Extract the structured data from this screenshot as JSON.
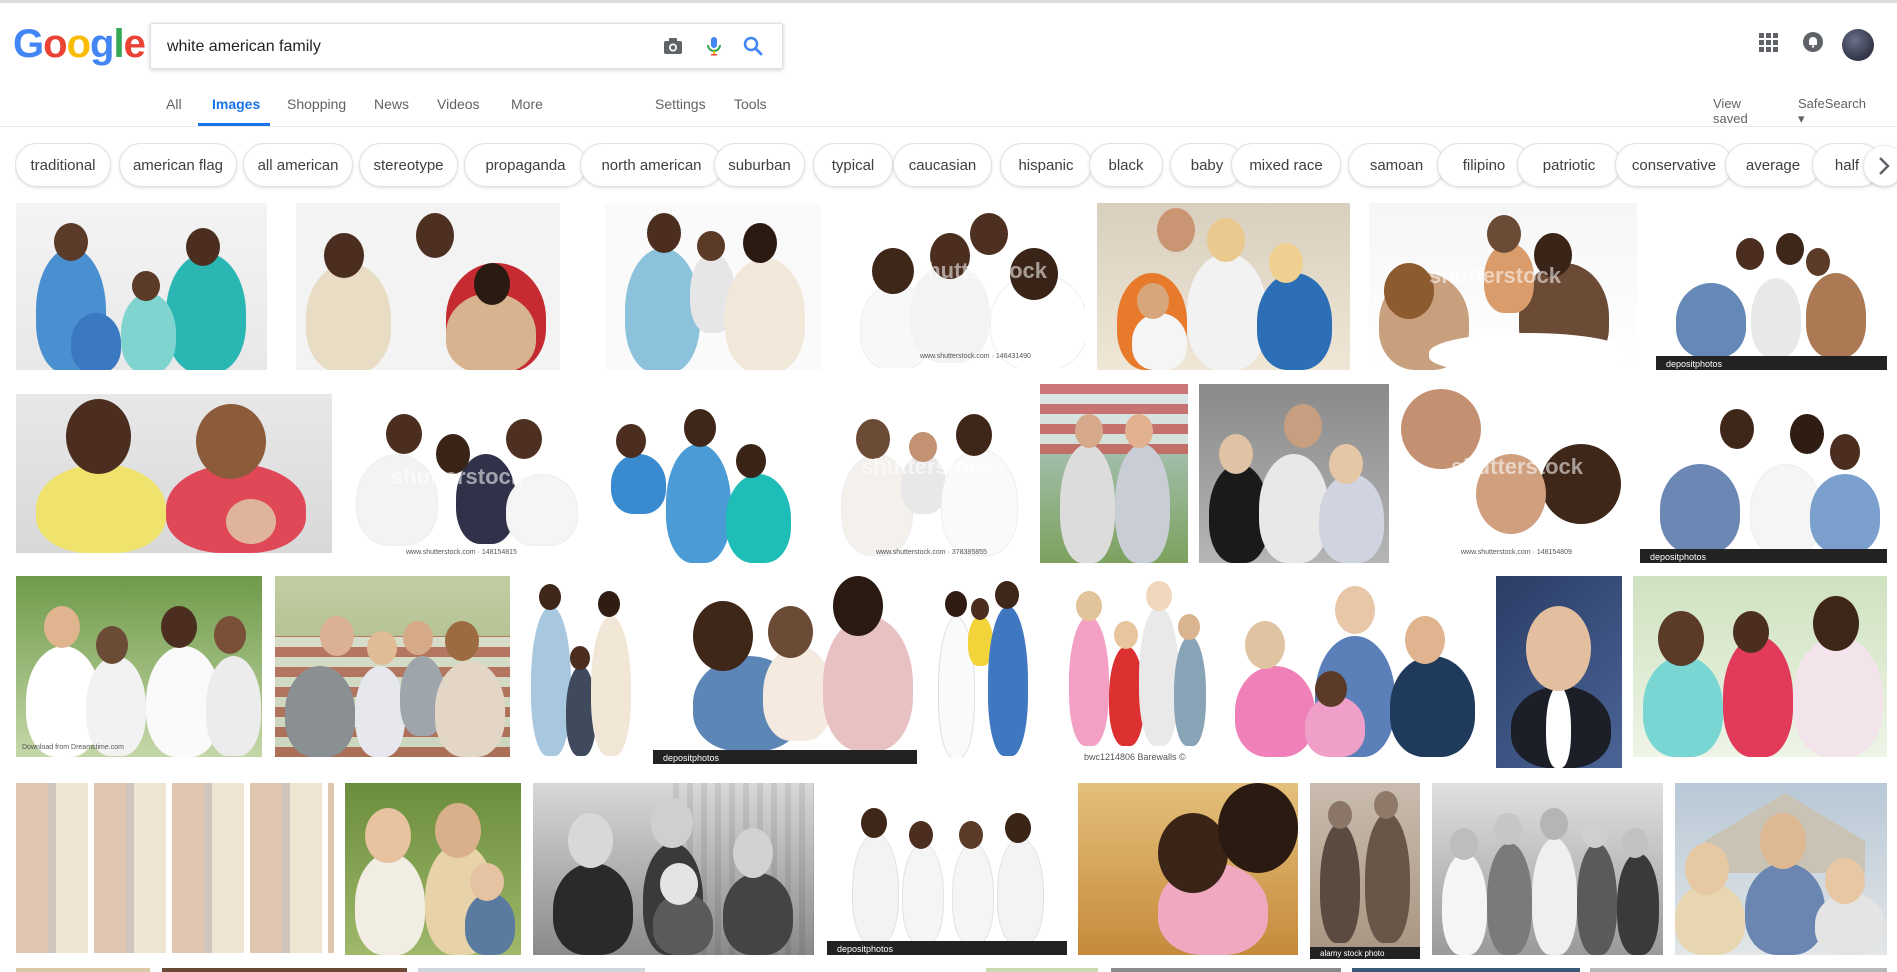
{
  "logo": {
    "text": "Google"
  },
  "search": {
    "query": "white american family",
    "camera_icon": "camera-icon",
    "mic_icon": "microphone-icon",
    "search_icon": "search-icon"
  },
  "header_icons": {
    "apps": "apps-grid-icon",
    "notifications": "bell-icon",
    "avatar": "avatar"
  },
  "nav": {
    "tabs": [
      "All",
      "Images",
      "Shopping",
      "News",
      "Videos",
      "More"
    ],
    "active": "Images",
    "settings": "Settings",
    "tools": "Tools",
    "view_saved": "View saved",
    "safesearch": "SafeSearch ▾"
  },
  "chips": [
    "traditional",
    "american flag",
    "all american",
    "stereotype",
    "propaganda",
    "north american",
    "suburban",
    "typical",
    "caucasian",
    "hispanic",
    "black",
    "baby",
    "mixed race",
    "samoan",
    "filipino",
    "patriotic",
    "conservative",
    "average",
    "half"
  ],
  "thumbnails": {
    "watermark": "shutterstock",
    "depositphotos": "depositphotos",
    "captions": [
      "www.shutterstock.com · 146431490",
      "www.shutterstock.com · 148154815",
      "www.shutterstock.com · 378385855",
      "www.shutterstock.com · 148154809",
      "bwc1214806 Barewalls ©",
      "alamy stock photo",
      "Download from Dreamstime.com"
    ]
  },
  "colors": {
    "blue": "#4285F4",
    "red": "#EA4335",
    "yellow": "#FBBC05",
    "green": "#34A853",
    "active_tab": "#1a73e8"
  }
}
